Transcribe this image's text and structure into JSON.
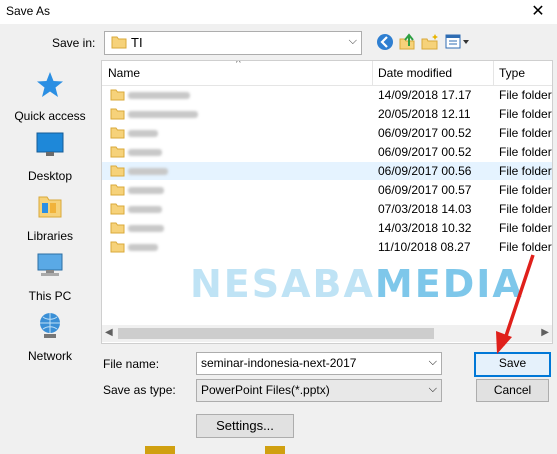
{
  "window": {
    "title": "Save As",
    "close_glyph": "✕"
  },
  "toolbar": {
    "save_in_label": "Save in:",
    "save_in_value": "TI",
    "buttons": [
      "back-icon",
      "up-folder-icon",
      "new-folder-icon",
      "view-menu-icon"
    ]
  },
  "places": [
    {
      "label": "Quick access",
      "icon": "star-icon"
    },
    {
      "label": "Desktop",
      "icon": "desktop-icon"
    },
    {
      "label": "Libraries",
      "icon": "libraries-icon"
    },
    {
      "label": "This PC",
      "icon": "computer-icon"
    },
    {
      "label": "Network",
      "icon": "network-icon"
    }
  ],
  "list": {
    "columns": [
      "Name",
      "Date modified",
      "Type"
    ],
    "rows": [
      {
        "date": "14/09/2018 17.17",
        "type": "File folder"
      },
      {
        "date": "20/05/2018 12.11",
        "type": "File folder"
      },
      {
        "date": "06/09/2017 00.52",
        "type": "File folder"
      },
      {
        "date": "06/09/2017 00.52",
        "type": "File folder"
      },
      {
        "date": "06/09/2017 00.56",
        "type": "File folder",
        "selected": true
      },
      {
        "date": "06/09/2017 00.57",
        "type": "File folder"
      },
      {
        "date": "07/03/2018 14.03",
        "type": "File folder"
      },
      {
        "date": "14/03/2018 10.32",
        "type": "File folder"
      },
      {
        "date": "11/10/2018 08.27",
        "type": "File folder"
      }
    ]
  },
  "watermark": {
    "part1": "NESABA",
    "part2": "MEDIA"
  },
  "form": {
    "file_name_label": "File name:",
    "file_name_value": "seminar-indonesia-next-2017",
    "save_type_label": "Save as type:",
    "save_type_value": "PowerPoint Files(*.pptx)",
    "save_button": "Save",
    "cancel_button": "Cancel",
    "settings_button": "Settings..."
  },
  "colors": {
    "accent": "#0078d7",
    "annotation_arrow": "#e0201b",
    "selection": "#e5f3ff",
    "folder": "#f6d27a"
  }
}
